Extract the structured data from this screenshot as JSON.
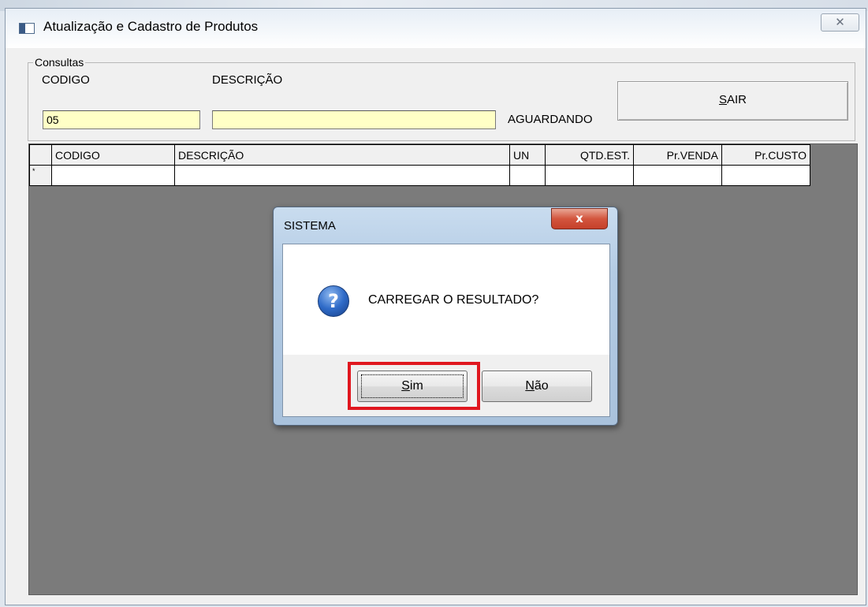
{
  "window": {
    "title": "Atualização e Cadastro de Produtos",
    "close_glyph": "✕"
  },
  "consultas": {
    "legend": "Consultas",
    "codigo_label": "CODIGO",
    "codigo_value": "05",
    "descricao_label": "DESCRIÇÃO",
    "descricao_value": "",
    "status": "AGUARDANDO",
    "sair_prefix": "",
    "sair_mnemonic": "S",
    "sair_rest": "AIR"
  },
  "grid": {
    "columns": [
      "CODIGO",
      "DESCRIÇÃO",
      "UN",
      "QTD.EST.",
      "Pr.VENDA",
      "Pr.CUSTO"
    ],
    "new_row_indicator": "*"
  },
  "dialog": {
    "title": "SISTEMA",
    "close_glyph": "x",
    "message": "CARREGAR O RESULTADO?",
    "icon": "question-icon",
    "icon_glyph": "?",
    "yes_mnemonic": "S",
    "yes_rest": "im",
    "no_mnemonic": "N",
    "no_rest": "ão"
  },
  "colors": {
    "input_bg": "#ffffc6",
    "grid_bg": "#7b7b7b",
    "highlight": "#e0171f"
  }
}
